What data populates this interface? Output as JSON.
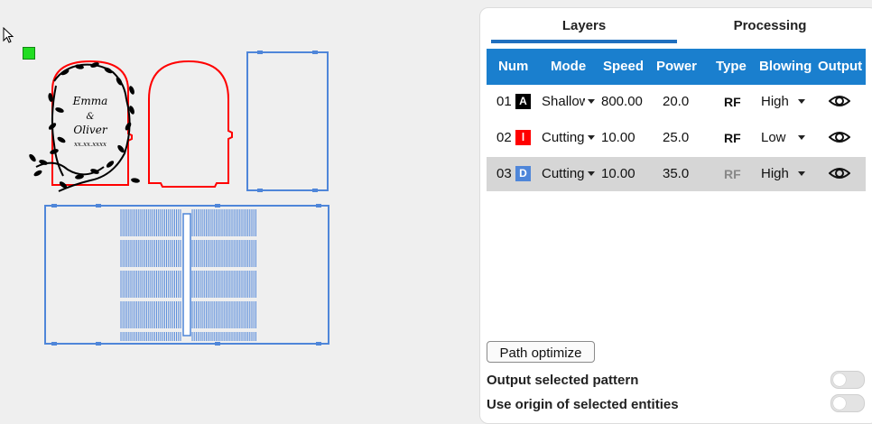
{
  "tabs": {
    "layers": "Layers",
    "processing": "Processing",
    "active": "layers"
  },
  "table": {
    "headers": [
      "Num",
      "Mode",
      "Speed",
      "Power",
      "Type",
      "Blowing",
      "Output"
    ],
    "rows": [
      {
        "num": "01",
        "chip": "A",
        "chip_color": "#000000",
        "mode": "Shallow",
        "speed": "800.00",
        "power": "20.0",
        "type": "RF",
        "blowing": "High",
        "selected": false
      },
      {
        "num": "02",
        "chip": "l",
        "chip_color": "#ff0000",
        "mode": "Cutting",
        "speed": "10.00",
        "power": "25.0",
        "type": "RF",
        "blowing": "Low",
        "selected": false
      },
      {
        "num": "03",
        "chip": "D",
        "chip_color": "#4f86d9",
        "mode": "Cutting",
        "speed": "10.00",
        "power": "35.0",
        "type": "RF",
        "blowing": "High",
        "selected": true
      }
    ]
  },
  "actions": {
    "path_optimize": "Path optimize"
  },
  "options": [
    {
      "label": "Output selected pattern",
      "enabled": false
    },
    {
      "label": "Use origin of selected entities",
      "enabled": false
    }
  ],
  "colors": {
    "accent": "#1a7fce",
    "cut_red": "#ff0000",
    "select_blue": "#4f86d9",
    "origin_green": "#22dd22"
  },
  "canvas": {
    "engraving_text": [
      "Emma",
      "&",
      "Oliver",
      "xx.xx.xxxx"
    ]
  }
}
